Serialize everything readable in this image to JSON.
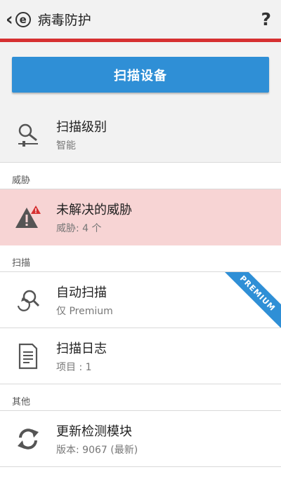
{
  "header": {
    "title": "病毒防护",
    "logo_letter": "e",
    "help_symbol": "?"
  },
  "scan_button": {
    "label": "扫描设备"
  },
  "scan_level": {
    "title": "扫描级别",
    "subtitle": "智能"
  },
  "sections": {
    "threats": "威胁",
    "scan": "扫描",
    "other": "其他"
  },
  "unresolved_threats": {
    "title": "未解决的威胁",
    "subtitle": "威胁: 4 个"
  },
  "auto_scan": {
    "title": "自动扫描",
    "subtitle": "仅 Premium",
    "ribbon": "PREMIUM"
  },
  "scan_log": {
    "title": "扫描日志",
    "subtitle": "项目 : 1"
  },
  "update_modules": {
    "title": "更新检测模块",
    "subtitle": "版本: 9067 (最新)"
  },
  "colors": {
    "accent_blue": "#2f8fd6",
    "alert_red": "#d63031",
    "threat_bg": "#f7d4d4"
  }
}
